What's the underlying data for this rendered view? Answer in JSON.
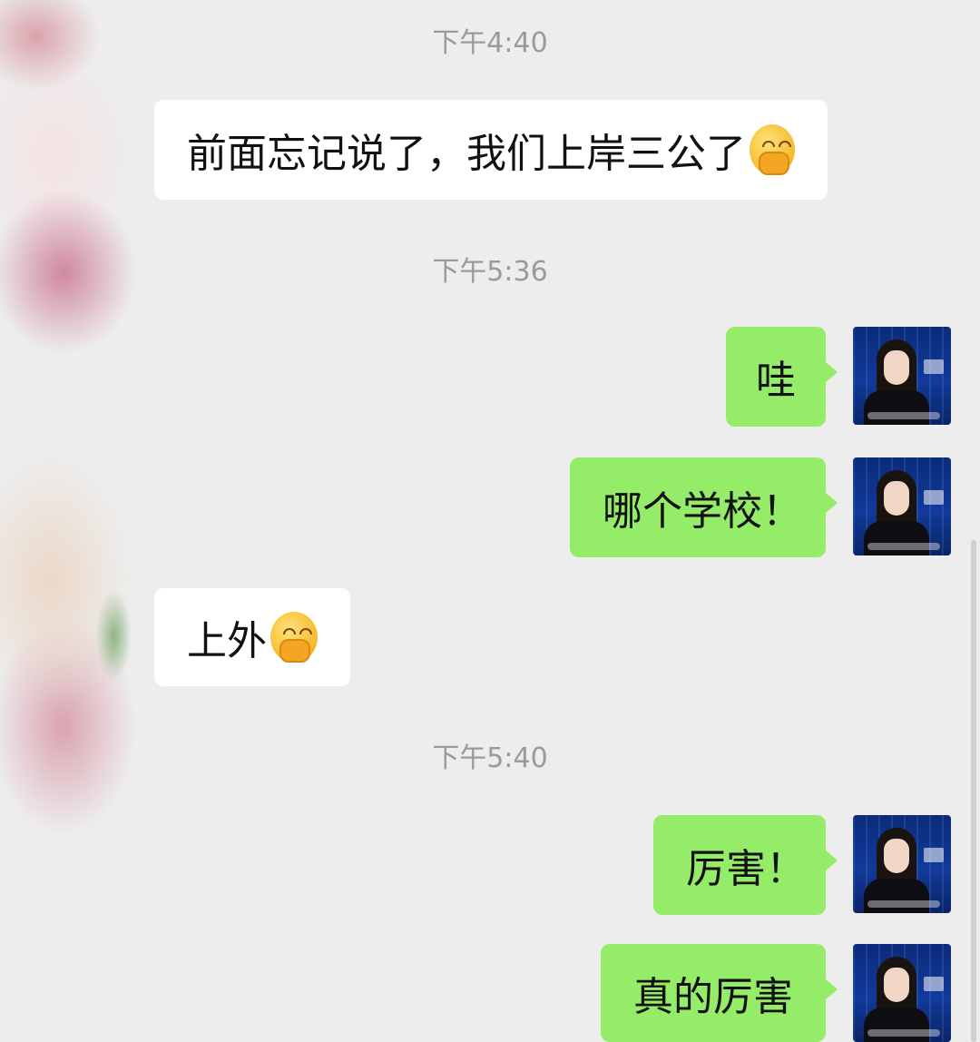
{
  "timestamps": [
    "下午4:40",
    "下午5:36",
    "下午5:40"
  ],
  "messages": [
    {
      "side": "in",
      "text": "前面忘记说了，我们上岸三公了",
      "emoji": "hand-over-mouth-emoji"
    },
    {
      "side": "out",
      "text": "哇"
    },
    {
      "side": "out",
      "text": "哪个学校！"
    },
    {
      "side": "in",
      "text": "上外",
      "emoji": "hand-over-mouth-emoji"
    },
    {
      "side": "out",
      "text": "厉害！"
    },
    {
      "side": "out",
      "text": "真的厉害"
    }
  ],
  "colors": {
    "background": "#ededed",
    "incoming": "#ffffff",
    "outgoing": "#95ec69",
    "timestamp": "#9a9a9a"
  }
}
